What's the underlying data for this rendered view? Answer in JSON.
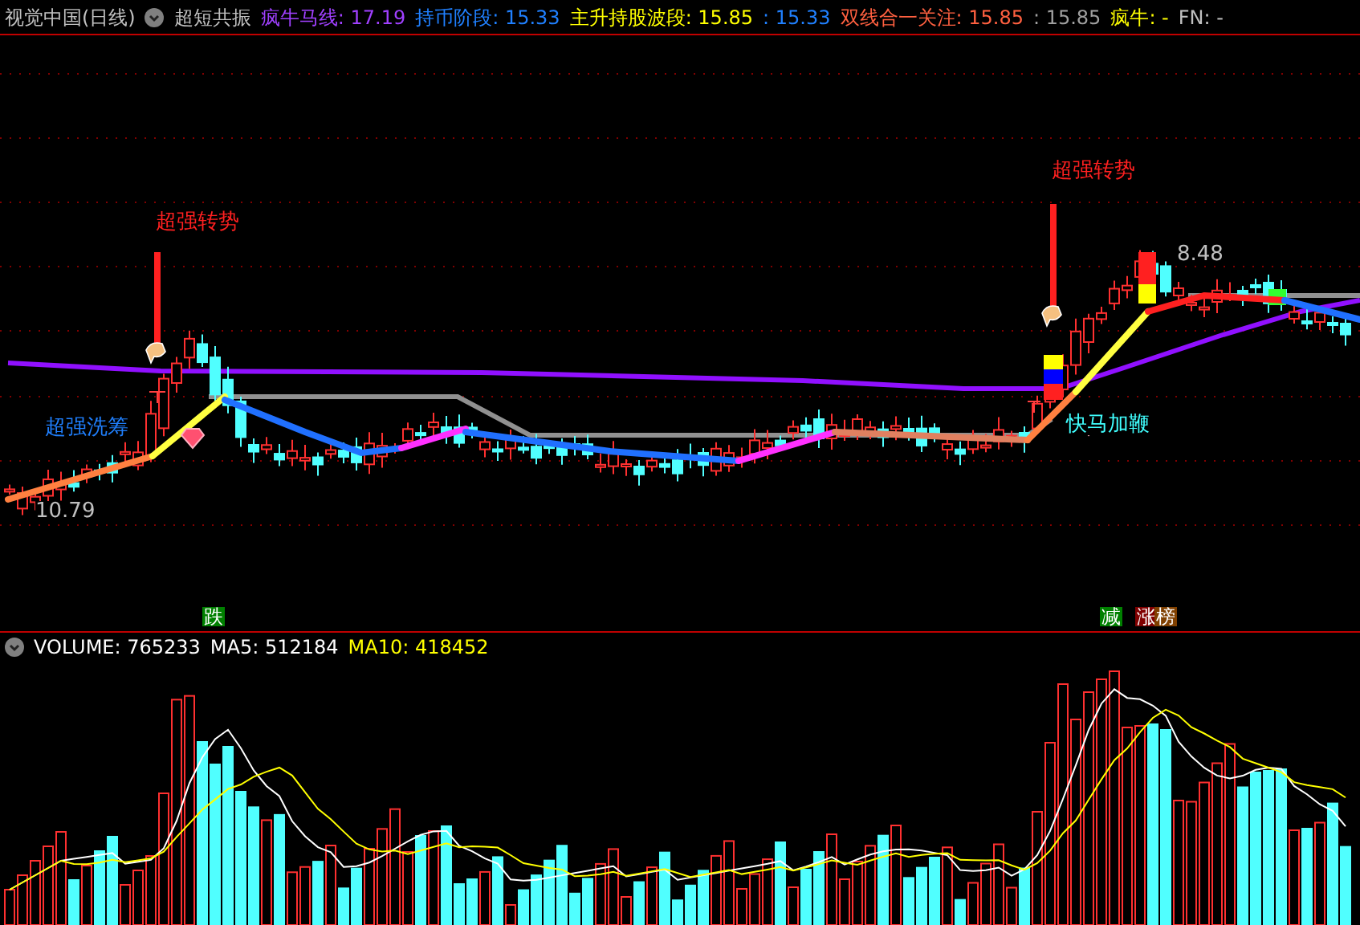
{
  "header": {
    "title": "视觉中国(日线)",
    "indicator": "超短共振",
    "values": [
      {
        "text": "疯牛马线: 17.19",
        "color": "#a040ff"
      },
      {
        "text": "持币阶段: 15.33",
        "color": "#2080ff"
      },
      {
        "text": "主升持股波段: 15.85",
        "color": "#ffff00"
      },
      {
        "text": ": 15.33",
        "color": "#2080ff"
      },
      {
        "text": "双线合一关注: 15.85",
        "color": "#ff6040"
      },
      {
        "text": ": 15.85",
        "color": "#a0a0a0"
      },
      {
        "text": "疯牛: -",
        "color": "#ffff00"
      },
      {
        "text": "FN: -",
        "color": "#c0c0c0"
      }
    ]
  },
  "annotations": [
    {
      "text": "超强转势",
      "color": "#ff2020"
    },
    {
      "text": "超强转势",
      "color": "#ff2020"
    },
    {
      "text": "超强洗筹",
      "color": "#2080ff"
    },
    {
      "text": "快马加鞭",
      "color": "#40ffff"
    },
    {
      "text": "10.79",
      "color": "#c0c0c0"
    },
    {
      "text": "8.48",
      "color": "#c0c0c0"
    }
  ],
  "markers": [
    {
      "text": "跌",
      "color": "#008000"
    },
    {
      "text": "减",
      "color": "#008000"
    },
    {
      "text": "涨",
      "color": "#800000"
    },
    {
      "text": "榜",
      "color": "#804000"
    }
  ],
  "volume_header": [
    {
      "text": "VOLUME: 765233",
      "color": "#ffffff"
    },
    {
      "text": "MA5: 512184",
      "color": "#ffffff"
    },
    {
      "text": "MA10: 418452",
      "color": "#ffff00"
    }
  ]
}
